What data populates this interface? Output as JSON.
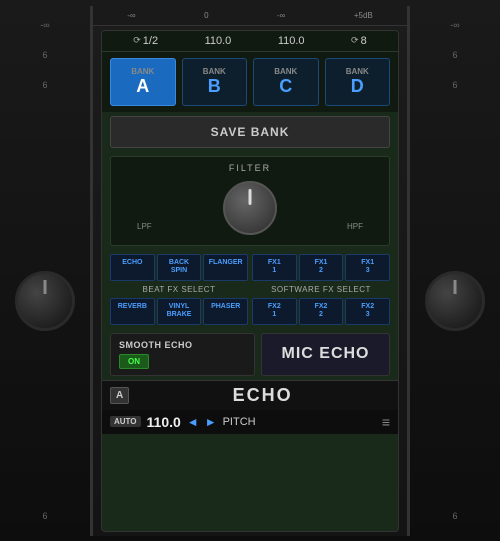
{
  "ruler": {
    "marks": [
      "-∞",
      "0",
      "-∞",
      "+5dB"
    ]
  },
  "infoBar": {
    "bpm1_icon": "⟳",
    "fraction": "1/2",
    "bpm1": "110.0",
    "bpm2": "110.0",
    "bpm2_icon": "⟳",
    "beats": "8"
  },
  "banks": [
    {
      "label": "BANK",
      "letter": "A",
      "active": true
    },
    {
      "label": "BANK",
      "letter": "B",
      "active": false
    },
    {
      "label": "BANK",
      "letter": "C",
      "active": false
    },
    {
      "label": "BANK",
      "letter": "D",
      "active": false
    }
  ],
  "saveBankLabel": "SAVE BANK",
  "filter": {
    "title": "FILTER",
    "leftLabel": "LPF",
    "rightLabel": "HPF"
  },
  "beatFx": {
    "sectionLabel": "BEAT FX SELECT",
    "buttons": [
      {
        "label": "ECHO"
      },
      {
        "label": "BACK\nSPIN"
      },
      {
        "label": "FLANGER"
      }
    ],
    "bottomButtons": [
      {
        "label": "REVERB"
      },
      {
        "label": "VINYL\nBRAKE"
      },
      {
        "label": "PHASER"
      }
    ]
  },
  "softwareFx": {
    "sectionLabel": "SOFTWARE FX SELECT",
    "row1": [
      {
        "label": "FX1\n1"
      },
      {
        "label": "FX1\n2"
      },
      {
        "label": "FX1\n3"
      }
    ],
    "row2": [
      {
        "label": "FX2\n1"
      },
      {
        "label": "FX2\n2"
      },
      {
        "label": "FX2\n3"
      }
    ]
  },
  "smoothEcho": {
    "title": "SMOOTH ECHO",
    "onLabel": "ON"
  },
  "micEcho": {
    "label": "MIC ECHO"
  },
  "bottomBar": {
    "bankBadge": "A",
    "title": "ECHO"
  },
  "transportBar": {
    "autoBadge": "AUTO",
    "bpm": "110.0",
    "prevArrow": "◄",
    "nextArrow": "►",
    "pitchLabel": "PITCH",
    "menuIcon": "≡"
  },
  "leftSide": {
    "ticks": [
      "-∞",
      "",
      "6",
      "",
      "6",
      ""
    ]
  },
  "rightSide": {
    "ticks": [
      "-∞",
      "",
      "6",
      "",
      "6",
      ""
    ]
  }
}
